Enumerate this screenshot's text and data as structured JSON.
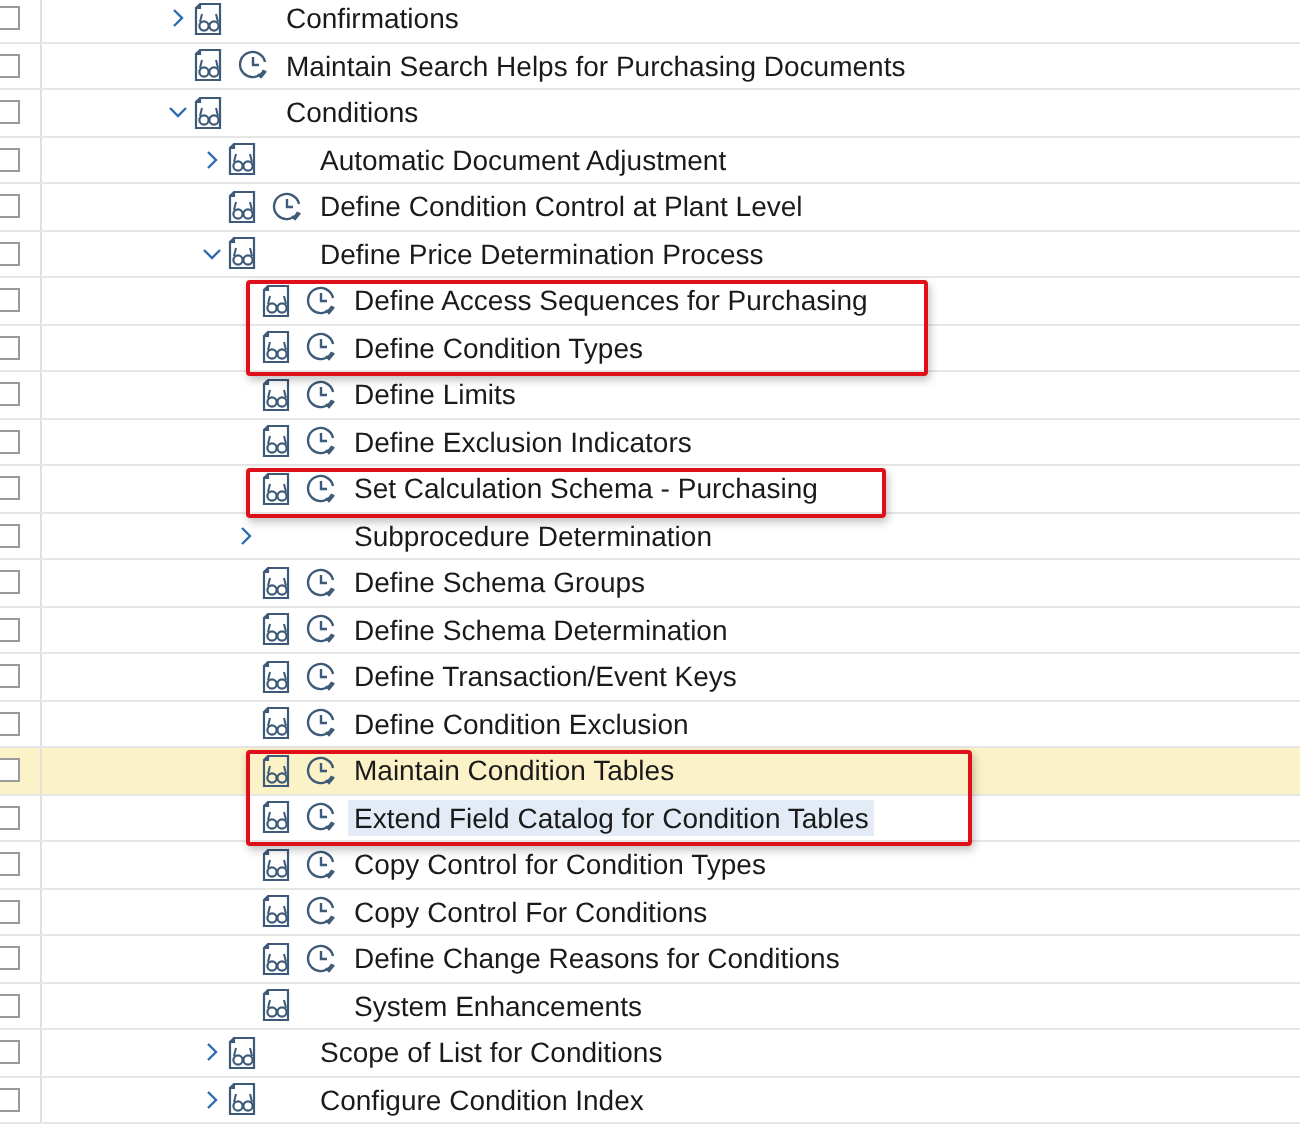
{
  "tree": [
    {
      "label": "Confirmations",
      "kind": "folder",
      "expanded": false,
      "selected": false,
      "focused": false,
      "boxed": false
    },
    {
      "label": "Maintain Search Helps for Purchasing Documents",
      "kind": "activity",
      "selected": false,
      "focused": false,
      "boxed": false
    },
    {
      "label": "Conditions",
      "kind": "folder",
      "expanded": true,
      "selected": false,
      "focused": false,
      "boxed": false,
      "children": [
        {
          "label": "Automatic Document Adjustment",
          "kind": "folder",
          "expanded": false,
          "selected": false,
          "focused": false,
          "boxed": false
        },
        {
          "label": "Define Condition Control at Plant Level",
          "kind": "activity",
          "selected": false,
          "focused": false,
          "boxed": false
        },
        {
          "label": "Define Price Determination Process",
          "kind": "folder",
          "expanded": true,
          "selected": false,
          "focused": false,
          "boxed": false,
          "children": [
            {
              "label": "Define Access Sequences for Purchasing",
              "kind": "activity",
              "selected": false,
              "focused": false,
              "boxed": true
            },
            {
              "label": "Define Condition Types",
              "kind": "activity",
              "selected": false,
              "focused": false,
              "boxed": true
            },
            {
              "label": "Define Limits",
              "kind": "activity",
              "selected": false,
              "focused": false,
              "boxed": false
            },
            {
              "label": "Define Exclusion Indicators",
              "kind": "activity",
              "selected": false,
              "focused": false,
              "boxed": false
            },
            {
              "label": "Set Calculation Schema - Purchasing",
              "kind": "activity",
              "selected": false,
              "focused": false,
              "boxed": true
            },
            {
              "label": "Subprocedure Determination",
              "kind": "group",
              "expanded": false,
              "selected": false,
              "focused": false,
              "boxed": false
            },
            {
              "label": "Define Schema Groups",
              "kind": "activity",
              "selected": false,
              "focused": false,
              "boxed": false
            },
            {
              "label": "Define Schema Determination",
              "kind": "activity",
              "selected": false,
              "focused": false,
              "boxed": false
            },
            {
              "label": "Define Transaction/Event Keys",
              "kind": "activity",
              "selected": false,
              "focused": false,
              "boxed": false
            },
            {
              "label": "Define Condition Exclusion",
              "kind": "activity",
              "selected": false,
              "focused": false,
              "boxed": false
            },
            {
              "label": "Maintain Condition Tables",
              "kind": "activity",
              "selected": true,
              "focused": false,
              "boxed": true
            },
            {
              "label": "Extend Field Catalog for Condition Tables",
              "kind": "activity",
              "selected": false,
              "focused": true,
              "boxed": true
            },
            {
              "label": "Copy Control for Condition Types",
              "kind": "activity",
              "selected": false,
              "focused": false,
              "boxed": false
            },
            {
              "label": "Copy Control For Conditions",
              "kind": "activity",
              "selected": false,
              "focused": false,
              "boxed": false
            },
            {
              "label": "Define Change Reasons for Conditions",
              "kind": "activity",
              "selected": false,
              "focused": false,
              "boxed": false
            },
            {
              "label": "System Enhancements",
              "kind": "document",
              "selected": false,
              "focused": false,
              "boxed": false
            }
          ]
        },
        {
          "label": "Scope of List for Conditions",
          "kind": "folder",
          "expanded": false,
          "selected": false,
          "focused": false,
          "boxed": false
        },
        {
          "label": "Configure Condition Index",
          "kind": "folder",
          "expanded": false,
          "selected": false,
          "focused": false,
          "boxed": false
        }
      ]
    }
  ]
}
